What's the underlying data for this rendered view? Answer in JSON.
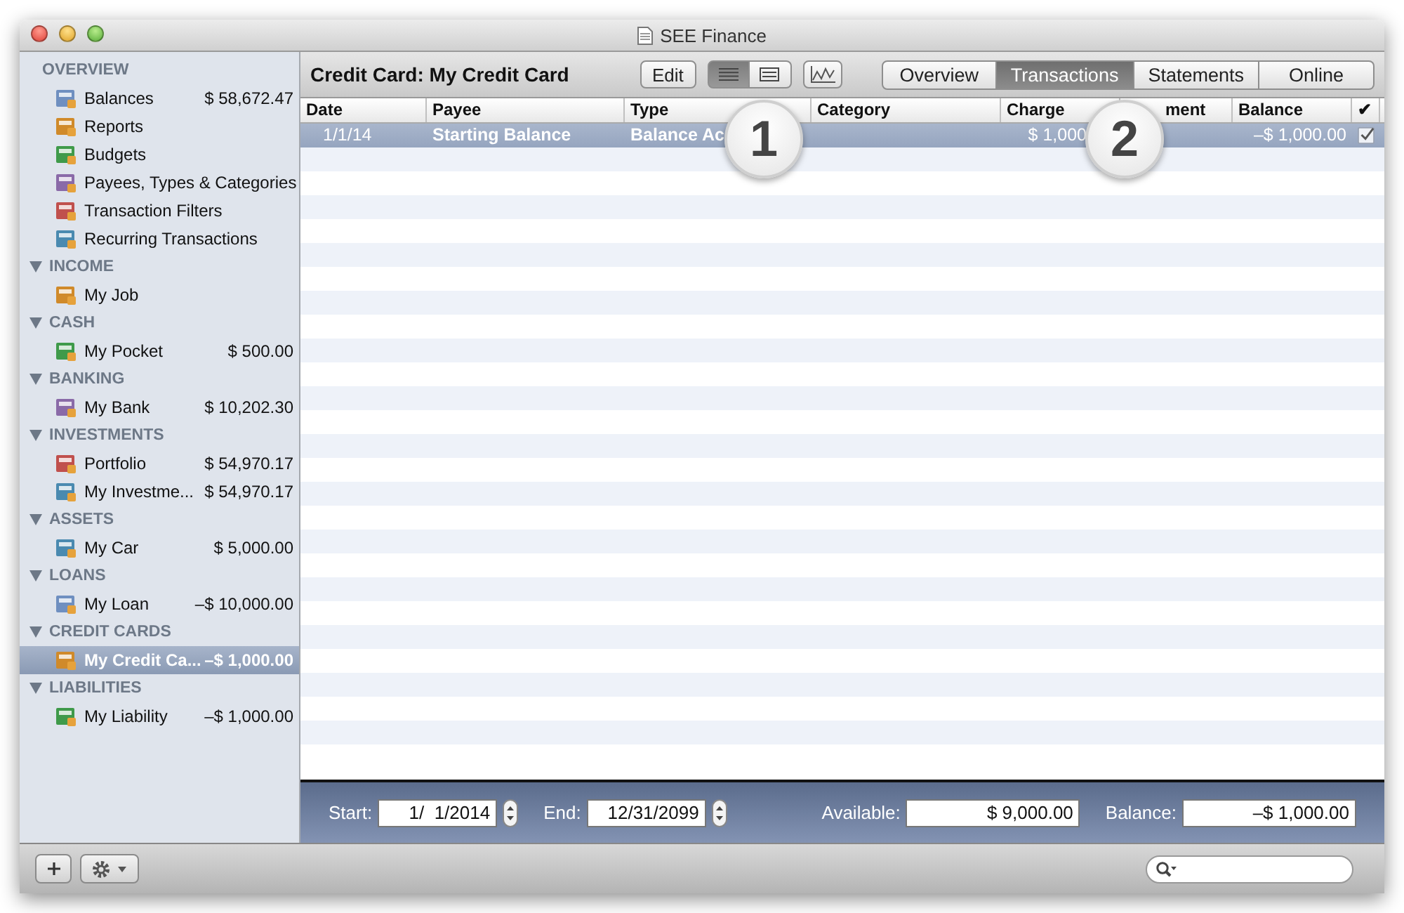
{
  "window": {
    "title": "SEE Finance"
  },
  "sidebar": {
    "sections": [
      {
        "title": "OVERVIEW",
        "items": [
          {
            "label": "Balances",
            "amount": "$ 58,672.47",
            "selected": false
          },
          {
            "label": "Reports",
            "selected": false
          },
          {
            "label": "Budgets",
            "selected": false
          },
          {
            "label": "Payees, Types & Categories",
            "selected": false
          },
          {
            "label": "Transaction Filters",
            "selected": false
          },
          {
            "label": "Recurring Transactions",
            "selected": false
          }
        ]
      },
      {
        "title": "INCOME",
        "expanded": true,
        "items": [
          {
            "label": "My Job",
            "selected": false
          }
        ]
      },
      {
        "title": "CASH",
        "expanded": true,
        "items": [
          {
            "label": "My Pocket",
            "amount": "$ 500.00",
            "selected": false
          }
        ]
      },
      {
        "title": "BANKING",
        "expanded": true,
        "items": [
          {
            "label": "My Bank",
            "amount": "$ 10,202.30",
            "selected": false
          }
        ]
      },
      {
        "title": "INVESTMENTS",
        "expanded": true,
        "items": [
          {
            "label": "Portfolio",
            "amount": "$ 54,970.17",
            "selected": false
          },
          {
            "label": "My Investme...",
            "amount": "$ 54,970.17",
            "selected": false
          }
        ]
      },
      {
        "title": "ASSETS",
        "expanded": true,
        "items": [
          {
            "label": "My Car",
            "amount": "$ 5,000.00",
            "selected": false
          }
        ]
      },
      {
        "title": "LOANS",
        "expanded": true,
        "items": [
          {
            "label": "My Loan",
            "amount": "–$ 10,000.00",
            "selected": false
          }
        ]
      },
      {
        "title": "CREDIT CARDS",
        "expanded": true,
        "items": [
          {
            "label": "My Credit Ca...",
            "amount": "–$ 1,000.00",
            "selected": true
          }
        ]
      },
      {
        "title": "LIABILITIES",
        "expanded": true,
        "items": [
          {
            "label": "My Liability",
            "amount": "–$ 1,000.00",
            "selected": false
          }
        ]
      }
    ]
  },
  "toolbar": {
    "title": "Credit Card: My Credit Card",
    "edit_button": "Edit",
    "view_modes": [
      {
        "kind": "list",
        "selected": true
      },
      {
        "kind": "detail",
        "selected": false
      }
    ],
    "tabs": [
      {
        "label": "Overview",
        "selected": false
      },
      {
        "label": "Transactions",
        "selected": true
      },
      {
        "label": "Statements",
        "selected": false
      },
      {
        "label": "Online",
        "selected": false
      }
    ]
  },
  "table": {
    "columns": [
      "Date",
      "Payee",
      "Type",
      "Category",
      "Charge",
      "ment",
      "Balance",
      "✔"
    ],
    "rows": [
      {
        "selected": true,
        "cleared": true,
        "cells": [
          "1/1/14",
          "Starting Balance",
          "Balance Ac",
          "",
          "$ 1,000",
          "",
          "–$ 1,000.00"
        ]
      }
    ]
  },
  "callouts": [
    "1",
    "2"
  ],
  "footer": {
    "start_label": "Start:",
    "start": "1/  1/2014",
    "end_label": "End:",
    "end": "12/31/2099",
    "available_label": "Available:",
    "available": "$ 9,000.00",
    "balance_label": "Balance:",
    "balance": "–$ 1,000.00"
  }
}
